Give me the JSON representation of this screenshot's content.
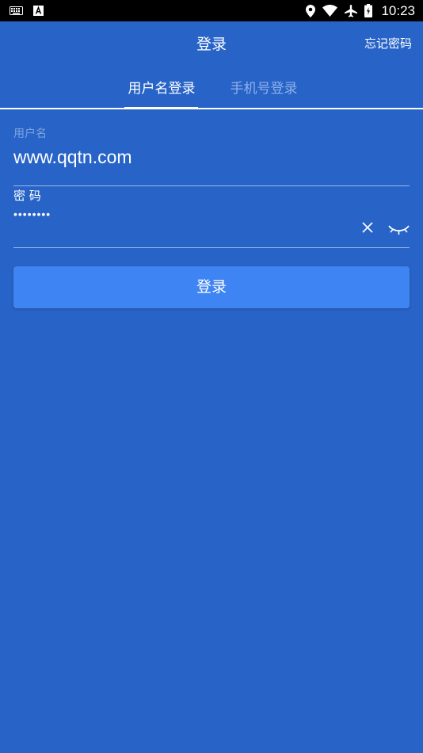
{
  "status_bar": {
    "time": "10:23",
    "left_icons": [
      "keyboard-icon",
      "text-input-icon"
    ],
    "right_icons": [
      "location-icon",
      "wifi-icon",
      "airplane-icon",
      "battery-icon"
    ]
  },
  "app_bar": {
    "title": "登录",
    "forgot_password": "忘记密码"
  },
  "tabs": [
    {
      "label": "用户名登录",
      "active": true
    },
    {
      "label": "手机号登录",
      "active": false
    }
  ],
  "form": {
    "username_label": "用户名",
    "username_value": "www.qqtn.com",
    "password_label": "密 码",
    "password_value": "••••••••",
    "icons": [
      "clear-icon",
      "eye-closed-icon"
    ]
  },
  "login_button": "登录",
  "colors": {
    "background": "#2864c8",
    "button": "#3f84f3",
    "inactive_tab": "#8fb0e8",
    "hint_label": "#7fa3de"
  }
}
